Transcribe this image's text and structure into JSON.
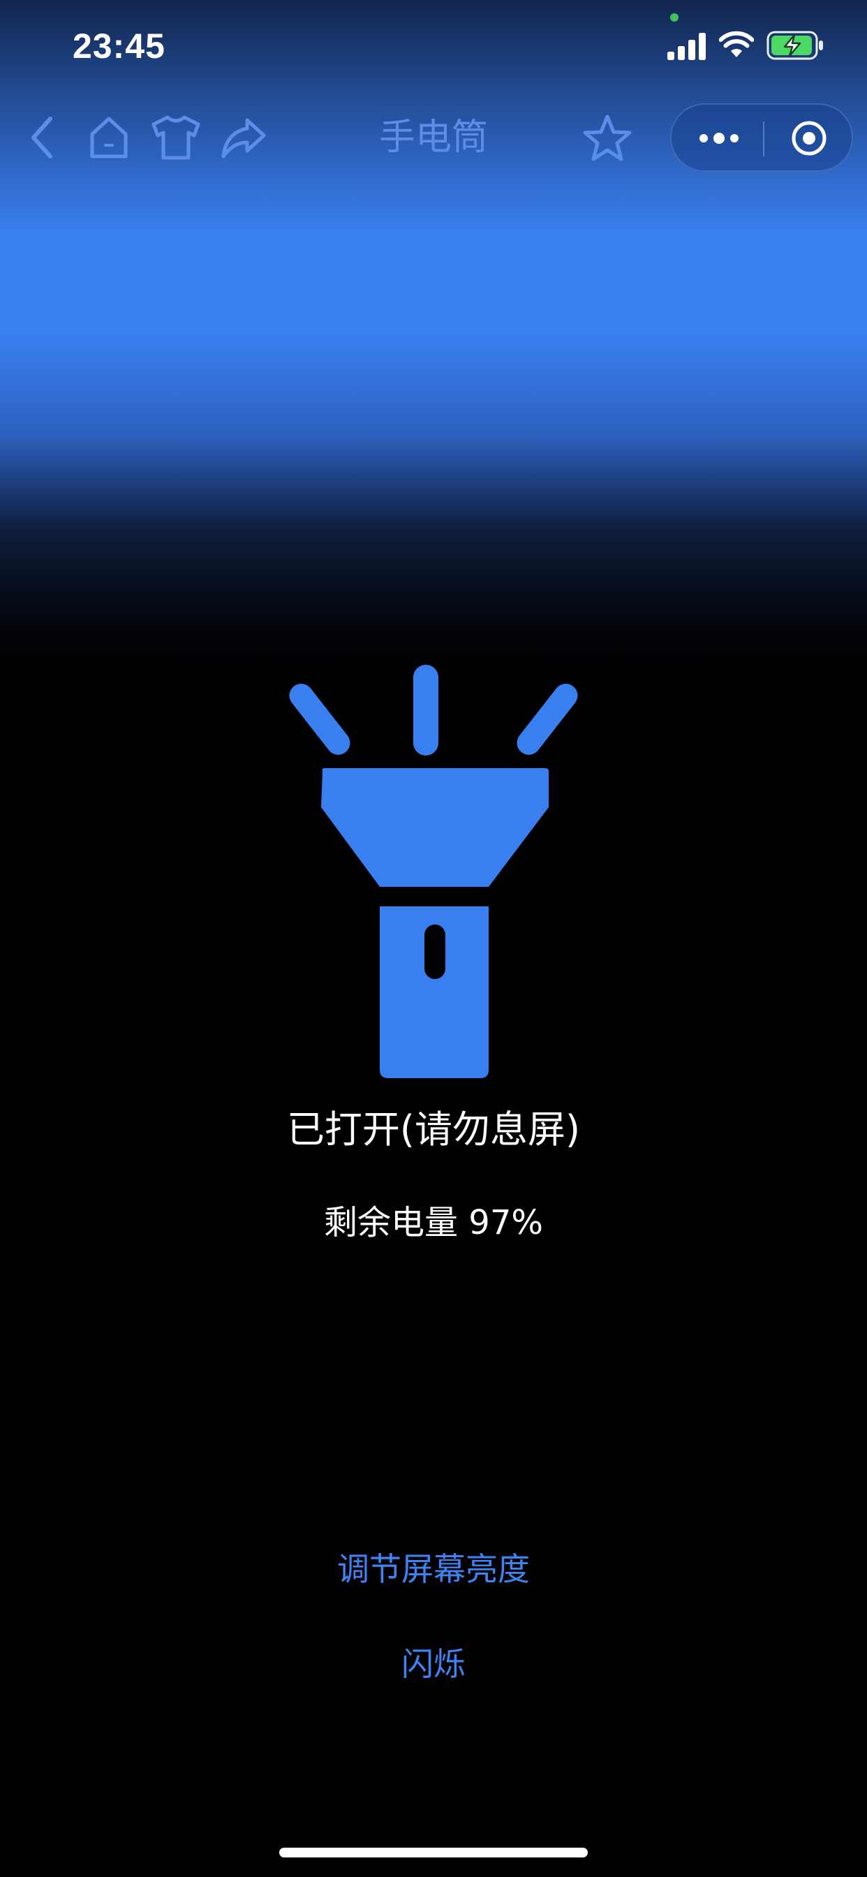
{
  "status_bar": {
    "time": "23:45"
  },
  "nav": {
    "title": "手电筒"
  },
  "main": {
    "status": "已打开(请勿息屏)",
    "battery": "剩余电量 97%",
    "battery_level_percent": 97
  },
  "actions": {
    "adjust_brightness": "调节屏幕亮度",
    "flash": "闪烁"
  },
  "colors": {
    "accent": "#3a7ff0",
    "nav_icon": "#5c8ee8",
    "link": "#3e83f2",
    "background_bottom": "#000000"
  },
  "icons": [
    "signal-icon",
    "wifi-icon",
    "battery-charging-icon",
    "back-icon",
    "home-icon",
    "shirt-icon",
    "share-icon",
    "star-icon",
    "more-icon",
    "target-icon",
    "flashlight-icon"
  ]
}
